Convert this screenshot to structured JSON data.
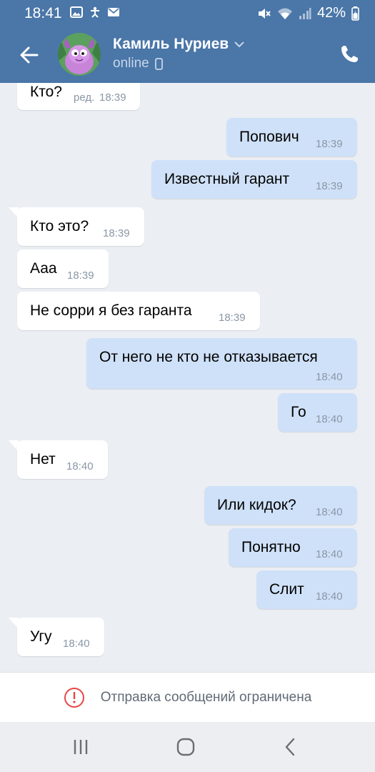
{
  "status_bar": {
    "time": "18:41",
    "battery": "42%"
  },
  "header": {
    "contact_name": "Камиль Нуриев",
    "status": "online"
  },
  "messages": [
    {
      "dir": "in",
      "text": "Кто?",
      "edited": "ред.",
      "time": "18:39"
    },
    {
      "dir": "out",
      "text": "Попович",
      "time": "18:39"
    },
    {
      "dir": "out",
      "text": "Известный гарант",
      "time": "18:39"
    },
    {
      "dir": "in",
      "text": "Кто это?",
      "time": "18:39"
    },
    {
      "dir": "in",
      "text": "Ааа",
      "time": "18:39"
    },
    {
      "dir": "in",
      "text": "Не сорри я без гаранта",
      "time": "18:39"
    },
    {
      "dir": "out",
      "text": "От него не кто не отказывается",
      "time": "18:40"
    },
    {
      "dir": "out",
      "text": "Го",
      "time": "18:40"
    },
    {
      "dir": "in",
      "text": "Нет",
      "time": "18:40"
    },
    {
      "dir": "out",
      "text": "Или кидок?",
      "time": "18:40"
    },
    {
      "dir": "out",
      "text": "Понятно",
      "time": "18:40"
    },
    {
      "dir": "out",
      "text": "Слит",
      "time": "18:40"
    },
    {
      "dir": "in",
      "text": "Угу",
      "time": "18:40"
    }
  ],
  "restriction_notice": "Отправка сообщений ограничена",
  "colors": {
    "header": "#4a76a8",
    "incoming": "#ffffff",
    "outgoing": "#cfe1f8",
    "alert": "#e64646"
  }
}
